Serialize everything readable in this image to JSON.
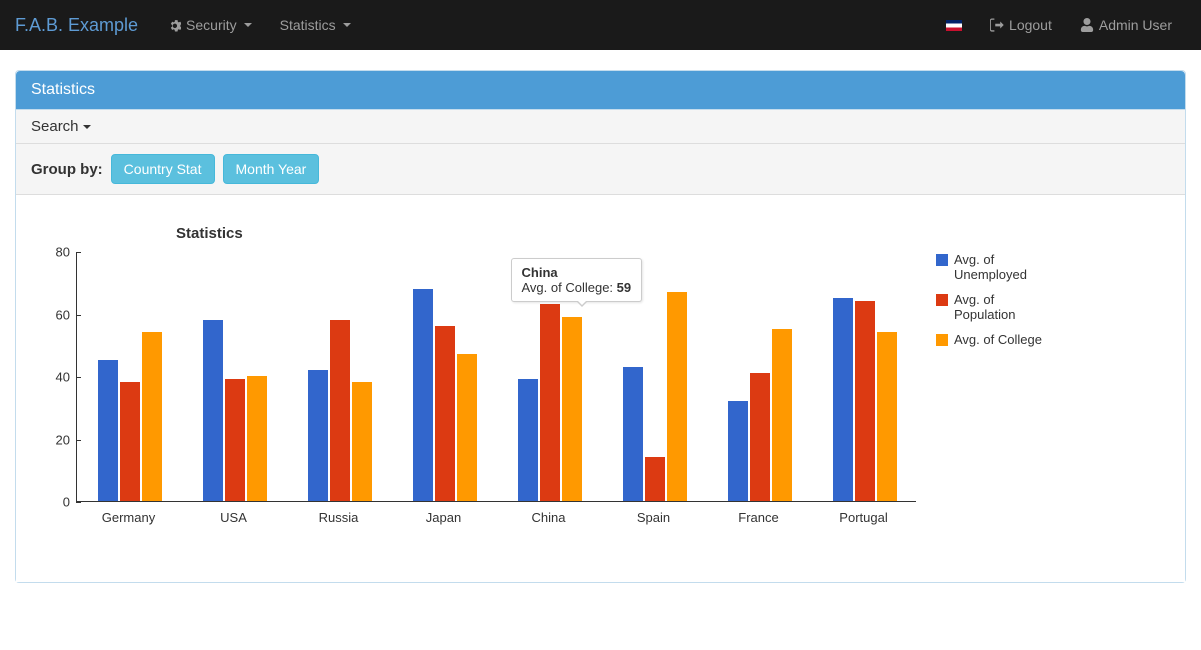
{
  "navbar": {
    "brand": "F.A.B. Example",
    "security": "Security",
    "statistics": "Statistics",
    "logout": "Logout",
    "user": "Admin User"
  },
  "panel": {
    "title": "Statistics",
    "search": "Search",
    "groupby_label": "Group by:",
    "btn_country": "Country Stat",
    "btn_month": "Month Year"
  },
  "legend": {
    "unemployed": "Avg. of Unemployed",
    "population": "Avg. of Population",
    "college": "Avg. of College"
  },
  "tooltip": {
    "title": "China",
    "metric": "Avg. of College: ",
    "value": "59"
  },
  "chart_data": {
    "type": "bar",
    "title": "Statistics",
    "ylim": [
      0,
      80
    ],
    "yticks": [
      0,
      20,
      40,
      60,
      80
    ],
    "categories": [
      "Germany",
      "USA",
      "Russia",
      "Japan",
      "China",
      "Spain",
      "France",
      "Portugal"
    ],
    "series": [
      {
        "name": "Avg. of Unemployed",
        "color": "#3266cc",
        "values": [
          45,
          58,
          42,
          68,
          39,
          43,
          32,
          65
        ]
      },
      {
        "name": "Avg. of Population",
        "color": "#dc3a12",
        "values": [
          38,
          39,
          58,
          56,
          63,
          14,
          41,
          64
        ]
      },
      {
        "name": "Avg. of College",
        "color": "#ff9900",
        "values": [
          54,
          40,
          38,
          47,
          59,
          67,
          55,
          54
        ]
      }
    ]
  }
}
